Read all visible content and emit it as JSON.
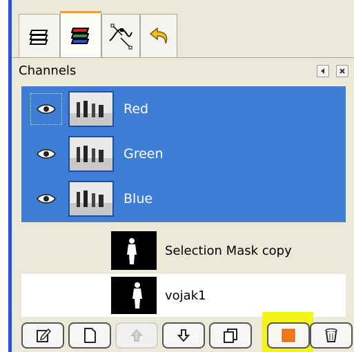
{
  "header": {
    "title": "Channels"
  },
  "tabs": [
    {
      "icon": "layers-icon"
    },
    {
      "icon": "channels-icon",
      "active": true
    },
    {
      "icon": "paths-icon"
    },
    {
      "icon": "undo-history-icon"
    }
  ],
  "channels": [
    {
      "label": "Red",
      "selected": true
    },
    {
      "label": "Green",
      "selected": true
    },
    {
      "label": "Blue",
      "selected": true
    }
  ],
  "saved_channels": [
    {
      "label": "Selection Mask copy"
    },
    {
      "label": "vojak1"
    }
  ],
  "buttons": [
    {
      "icon": "edit-channel-attributes-icon"
    },
    {
      "icon": "new-channel-icon"
    },
    {
      "icon": "raise-channel-icon",
      "disabled": true
    },
    {
      "icon": "lower-channel-icon"
    },
    {
      "icon": "duplicate-channel-icon"
    },
    {
      "icon": "channel-to-selection-icon",
      "highlighted": true
    },
    {
      "icon": "delete-channel-icon"
    }
  ],
  "colors": {
    "selection": "#3f7ed6",
    "selected_text": "#ffffff",
    "highlight": "#f5f41a",
    "active_tab_accent": "#f0a030"
  }
}
